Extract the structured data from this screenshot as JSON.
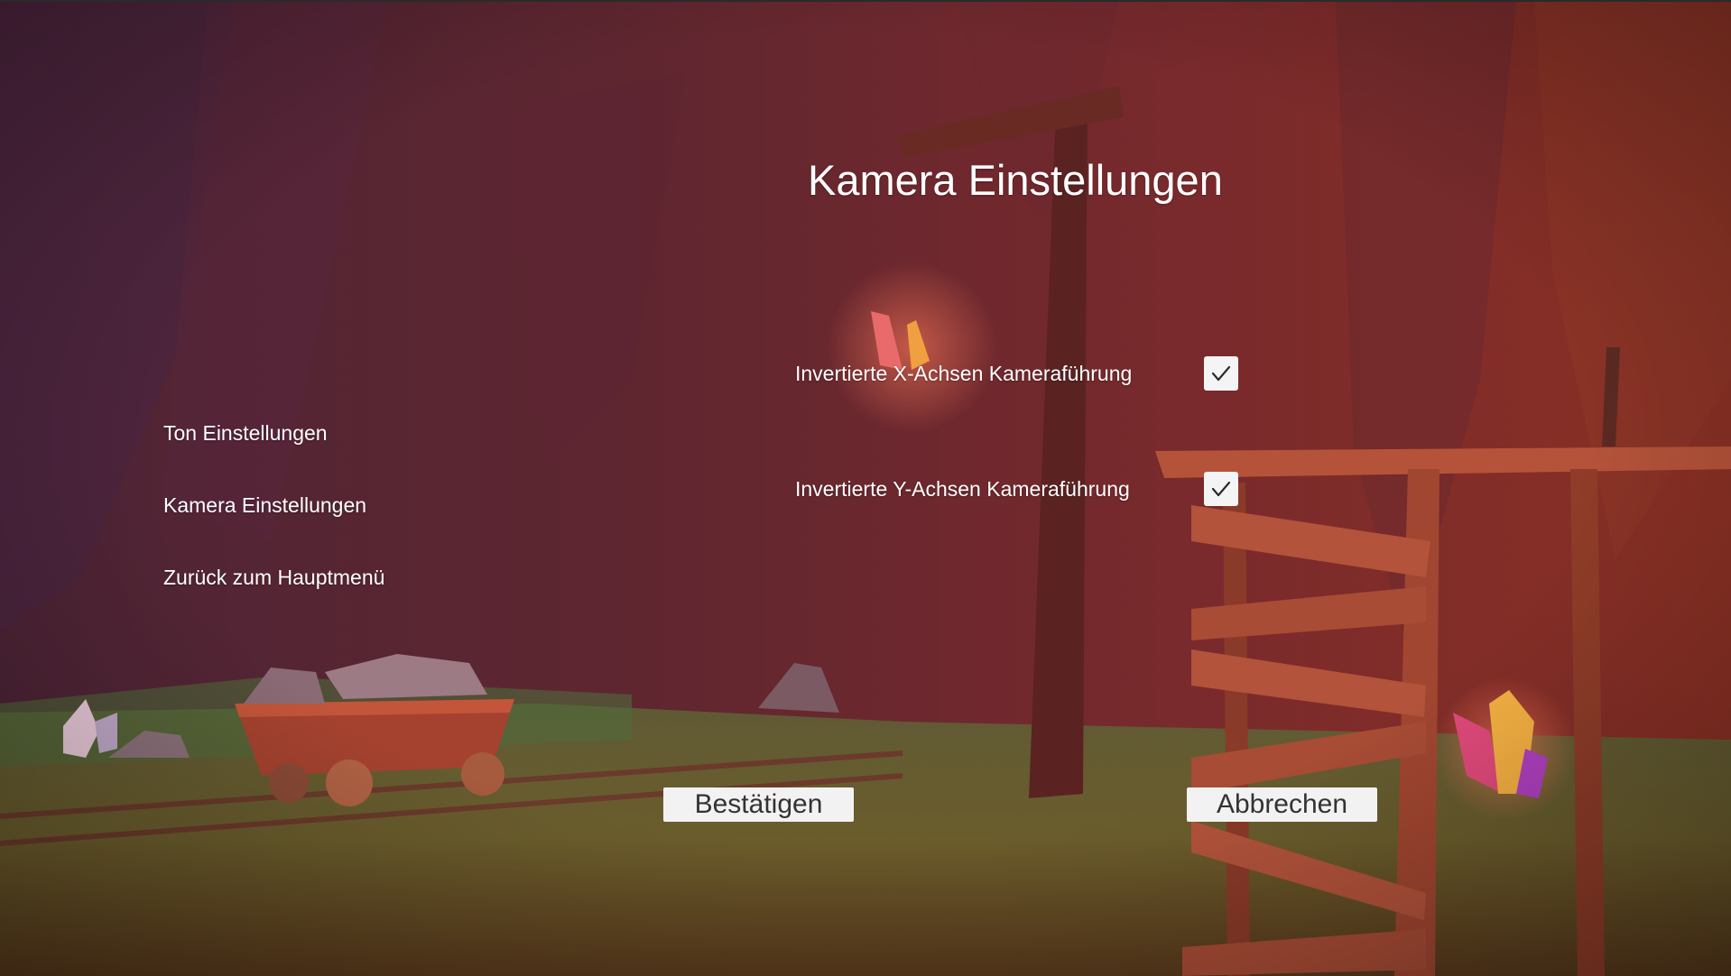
{
  "screen": {
    "title": "Kamera Einstellungen"
  },
  "sidebar": {
    "items": [
      {
        "label": "Ton Einstellungen"
      },
      {
        "label": "Kamera Einstellungen"
      },
      {
        "label": "Zurück zum Hauptmenü"
      }
    ]
  },
  "options": [
    {
      "label": "Invertierte X-Achsen Kameraführung",
      "checked": true
    },
    {
      "label": "Invertierte Y-Achsen Kameraführung",
      "checked": true
    }
  ],
  "buttons": {
    "confirm_label": "Bestätigen",
    "cancel_label": "Abbrechen"
  },
  "icons": {
    "checkbox_check": "check-icon"
  },
  "colors": {
    "text": "#ffffff",
    "button_bg": "#f2f2f2",
    "button_text": "#333333",
    "cave_wall": "#7a2a30",
    "ground": "#6f6a2a"
  }
}
